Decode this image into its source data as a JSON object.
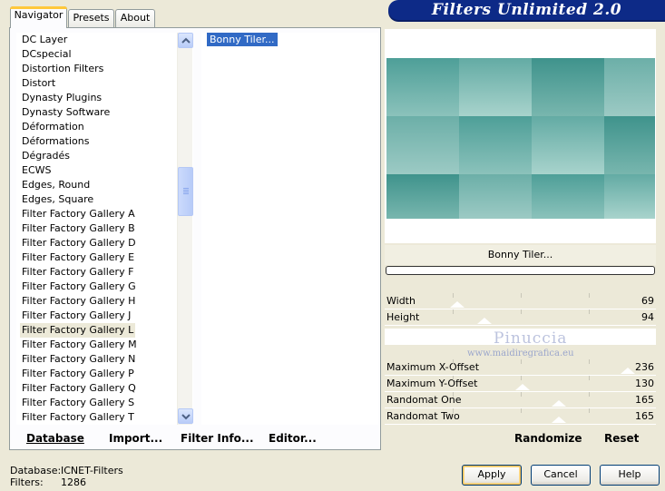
{
  "tabs": [
    {
      "label": "Navigator",
      "active": true
    },
    {
      "label": "Presets",
      "active": false
    },
    {
      "label": "About",
      "active": false
    }
  ],
  "banner": {
    "title": "Filters Unlimited 2.0"
  },
  "categories": {
    "items": [
      "DC Layer",
      "DCspecial",
      "Distortion Filters",
      "Distort",
      "Dynasty Plugins",
      "Dynasty Software",
      "Déformation",
      "Déformations",
      "Dégradés",
      "ECWS",
      "Edges, Round",
      "Edges, Square",
      "Filter Factory Gallery A",
      "Filter Factory Gallery B",
      "Filter Factory Gallery D",
      "Filter Factory Gallery E",
      "Filter Factory Gallery F",
      "Filter Factory Gallery G",
      "Filter Factory Gallery H",
      "Filter Factory Gallery J",
      "Filter Factory Gallery L",
      "Filter Factory Gallery M",
      "Filter Factory Gallery N",
      "Filter Factory Gallery P",
      "Filter Factory Gallery Q",
      "Filter Factory Gallery S",
      "Filter Factory Gallery T"
    ],
    "selected": "Filter Factory Gallery L"
  },
  "filters": {
    "items": [
      "Bonny Tiler..."
    ],
    "selected": "Bonny Tiler..."
  },
  "left_actions": {
    "database": "Database",
    "import": "Import...",
    "filter_info": "Filter Info...",
    "editor": "Editor..."
  },
  "preview": {
    "filter_name": "Bonny Tiler..."
  },
  "parameters": [
    {
      "label": "Width",
      "value": "69"
    },
    {
      "label": "Height",
      "value": "94"
    },
    {
      "label": "Maximum X-Offset",
      "value": "236"
    },
    {
      "label": "Maximum Y-Offset",
      "value": "130"
    },
    {
      "label": "Randomat One",
      "value": "165"
    },
    {
      "label": "Randomat Two",
      "value": "165"
    }
  ],
  "watermark": {
    "name": "Pinuccia",
    "url": "www.maidiregrafica.eu"
  },
  "right_actions": {
    "randomize": "Randomize",
    "reset": "Reset"
  },
  "status": {
    "database_label": "Database:",
    "database_value": "ICNET-Filters",
    "filters_label": "Filters:",
    "filters_value": "1286"
  },
  "buttons": {
    "apply": "Apply",
    "cancel": "Cancel",
    "help": "Help"
  },
  "colors": {
    "banner": "#0d2a87",
    "selection": "#316ac5",
    "preview_teal": "#5fa8a0"
  }
}
